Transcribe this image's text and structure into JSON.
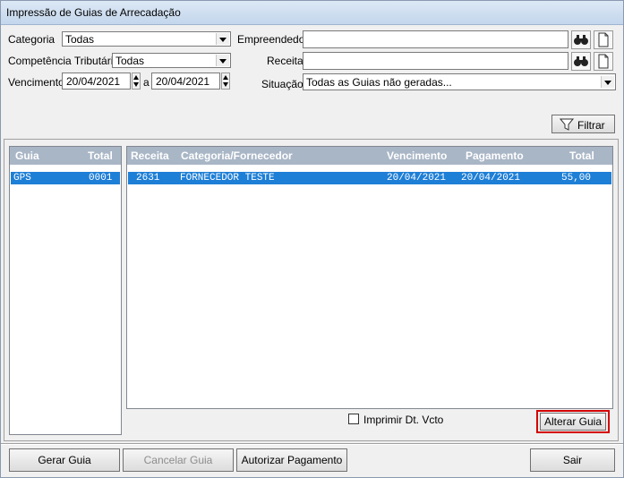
{
  "window": {
    "title": "Impressão de Guias de Arrecadação"
  },
  "filters": {
    "categoria_label": "Categoria",
    "categoria_value": "Todas",
    "competencia_label": "Competência Tributária",
    "competencia_value": "Todas",
    "vencimento_label": "Vencimento",
    "vencimento_from": "20/04/2021",
    "range_sep": "a",
    "vencimento_to": "20/04/2021",
    "empreendedor_label": "Empreendedor",
    "empreendedor_value": "",
    "receita_label": "Receita",
    "receita_value": "",
    "situacao_label": "Situação",
    "situacao_value": "Todas as Guias não geradas...",
    "filtrar_label": "Filtrar"
  },
  "guia_table": {
    "headers": [
      "Guia",
      "Total"
    ],
    "rows": [
      {
        "guia": "GPS",
        "total": "0001"
      }
    ]
  },
  "detail_table": {
    "headers": [
      "Receita",
      "Categoria/Fornecedor",
      "Vencimento",
      "Pagamento",
      "Total"
    ],
    "rows": [
      {
        "receita": "2631",
        "categoria": "FORNECEDOR TESTE",
        "vencimento": "20/04/2021",
        "pagamento": "20/04/2021",
        "total": "55,00"
      }
    ]
  },
  "options": {
    "imprimir_label": "Imprimir Dt. Vcto",
    "imprimir_checked": false,
    "alterar_label": "Alterar Guia"
  },
  "footer": {
    "gerar": "Gerar Guia",
    "cancelar": "Cancelar Guia",
    "autorizar": "Autorizar Pagamento",
    "sair": "Sair"
  },
  "colors": {
    "header_bg": "#a9b6c6",
    "selection": "#1e7fd6",
    "highlight_border": "#d40000"
  }
}
